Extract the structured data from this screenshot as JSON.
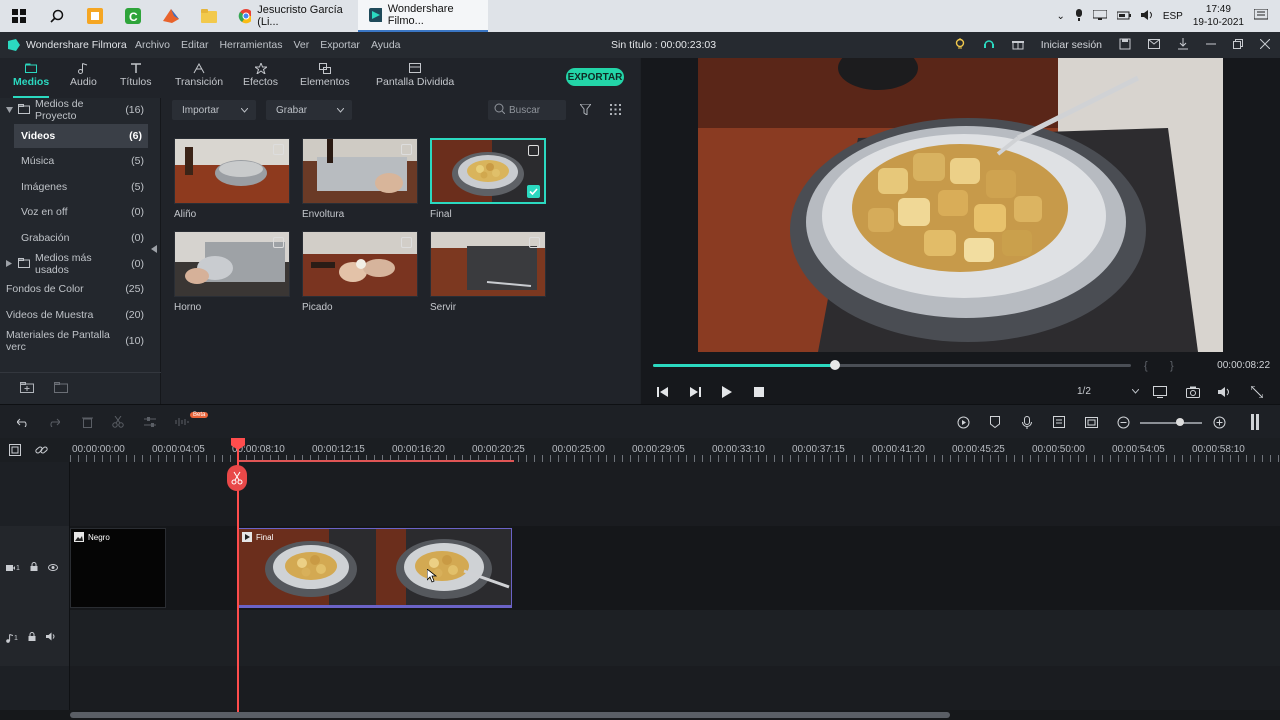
{
  "taskbar": {
    "apps": [
      {
        "label": "Jesucristo García (Li...",
        "icon": "chrome-icon"
      },
      {
        "label": "Wondershare Filmo...",
        "icon": "filmora-icon"
      }
    ],
    "lang": "ESP",
    "time": "17:49",
    "date": "19-10-2021"
  },
  "app": {
    "brand": "Wondershare Filmora",
    "menu": [
      "Archivo",
      "Editar",
      "Herramientas",
      "Ver",
      "Exportar",
      "Ayuda"
    ],
    "project_title": "Sin título : 00:00:23:03",
    "signin": "Iniciar sesión"
  },
  "tabs": [
    "Medios",
    "Audio",
    "Títulos",
    "Transición",
    "Efectos",
    "Elementos",
    "Pantalla Dividida"
  ],
  "export_label": "EXPORTAR",
  "sidebar": [
    {
      "label": "Medios de Proyecto",
      "count": "(16)"
    },
    {
      "label": "Videos",
      "count": "(6)"
    },
    {
      "label": "Música",
      "count": "(5)"
    },
    {
      "label": "Imágenes",
      "count": "(5)"
    },
    {
      "label": "Voz en off",
      "count": "(0)"
    },
    {
      "label": "Grabación",
      "count": "(0)"
    },
    {
      "label": "Medios más usados",
      "count": "(0)"
    },
    {
      "label": "Fondos de Color",
      "count": "(25)"
    },
    {
      "label": "Videos de Muestra",
      "count": "(20)"
    },
    {
      "label": "Materiales de Pantalla verc",
      "count": "(10)"
    }
  ],
  "media_toolbar": {
    "import": "Importar",
    "record": "Grabar",
    "search_placeholder": "Buscar"
  },
  "media": [
    {
      "name": "Aliño"
    },
    {
      "name": "Envoltura"
    },
    {
      "name": "Final"
    },
    {
      "name": "Horno"
    },
    {
      "name": "Picado"
    },
    {
      "name": "Servir"
    }
  ],
  "preview": {
    "time": "00:00:08:22",
    "ratio": "1/2",
    "progress": 0.38
  },
  "ruler": [
    "00:00:00:00",
    "00:00:04:05",
    "00:00:08:10",
    "00:00:12:15",
    "00:00:16:20",
    "00:00:20:25",
    "00:00:25:00",
    "00:00:29:05",
    "00:00:33:10",
    "00:00:37:15",
    "00:00:41:20",
    "00:00:45:25",
    "00:00:50:00",
    "00:00:54:05",
    "00:00:58:10"
  ],
  "timeline": {
    "video_track": "1",
    "audio_track": "1",
    "clips": [
      {
        "name": "Negro"
      },
      {
        "name": "Final"
      }
    ],
    "beta": "Beta"
  },
  "colors": {
    "accent": "#2bd9c0",
    "export": "#23d5a8",
    "playhead": "#ff4d4d"
  }
}
